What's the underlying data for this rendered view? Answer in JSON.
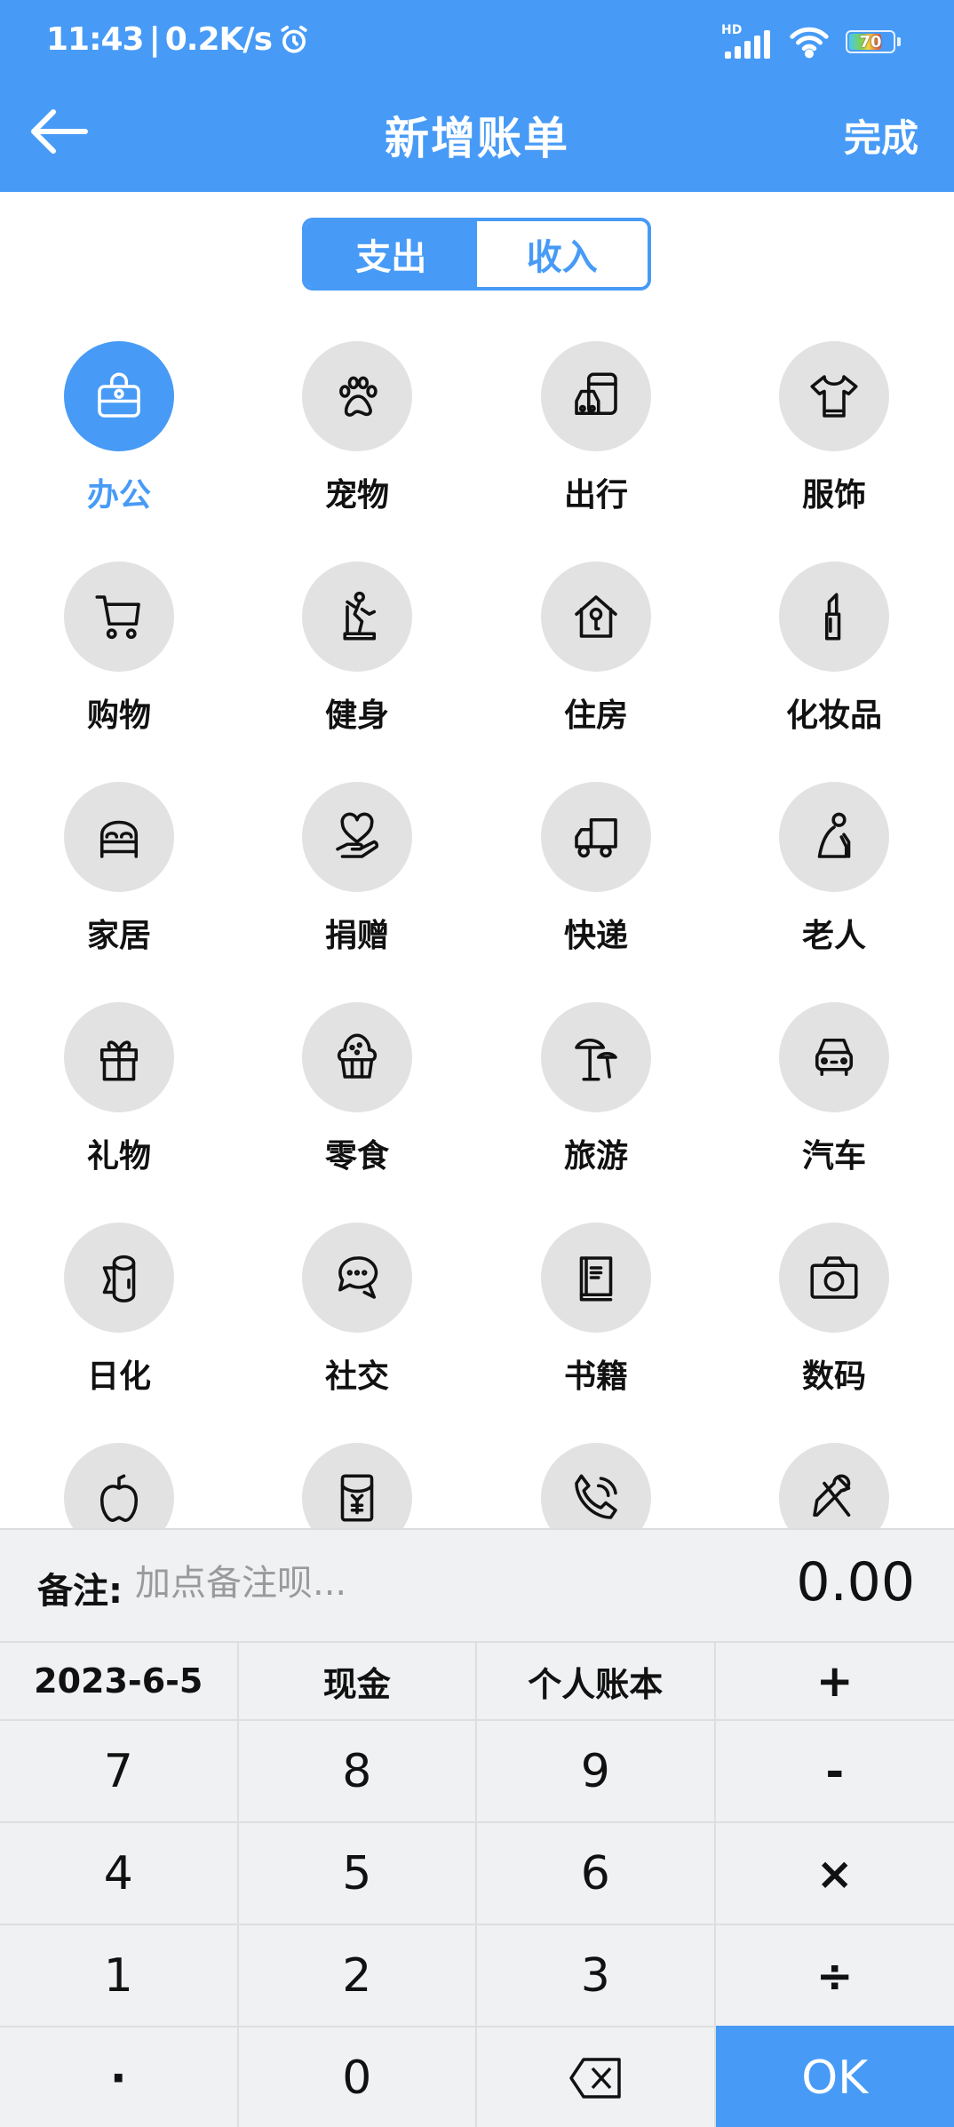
{
  "status_bar": {
    "time": "11:43",
    "net_speed": "0.2K/s",
    "alarm_icon": "alarm-clock-icon",
    "network_label": "HD",
    "battery_level": "70"
  },
  "header": {
    "back_icon": "arrow-left-icon",
    "title": "新增账单",
    "done_label": "完成"
  },
  "toggle": {
    "expense_label": "支出",
    "income_label": "收入",
    "selected": "支出"
  },
  "categories": [
    {
      "label": "办公",
      "icon": "briefcase-icon",
      "selected": true
    },
    {
      "label": "宠物",
      "icon": "paw-icon"
    },
    {
      "label": "出行",
      "icon": "bus-car-icon"
    },
    {
      "label": "服饰",
      "icon": "tshirt-icon"
    },
    {
      "label": "购物",
      "icon": "shopping-cart-icon"
    },
    {
      "label": "健身",
      "icon": "treadmill-icon"
    },
    {
      "label": "住房",
      "icon": "house-key-icon"
    },
    {
      "label": "化妆品",
      "icon": "lipstick-icon"
    },
    {
      "label": "家居",
      "icon": "bed-icon"
    },
    {
      "label": "捐赠",
      "icon": "heart-hand-icon"
    },
    {
      "label": "快递",
      "icon": "truck-icon"
    },
    {
      "label": "老人",
      "icon": "elderly-icon"
    },
    {
      "label": "礼物",
      "icon": "gift-icon"
    },
    {
      "label": "零食",
      "icon": "cupcake-icon"
    },
    {
      "label": "旅游",
      "icon": "beach-umbrella-icon"
    },
    {
      "label": "汽车",
      "icon": "car-icon"
    },
    {
      "label": "日化",
      "icon": "toilet-paper-icon"
    },
    {
      "label": "社交",
      "icon": "chat-bubbles-icon"
    },
    {
      "label": "书籍",
      "icon": "book-icon"
    },
    {
      "label": "数码",
      "icon": "camera-icon"
    },
    {
      "label": "",
      "icon": "apple-icon"
    },
    {
      "label": "",
      "icon": "red-envelope-icon"
    },
    {
      "label": "",
      "icon": "phone-icon"
    },
    {
      "label": "",
      "icon": "tools-icon"
    }
  ],
  "note": {
    "label": "备注:",
    "placeholder": "加点备注呗...",
    "value": ""
  },
  "amount": "0.00",
  "keypad": {
    "date": "2023-6-5",
    "account": "现金",
    "book": "个人账本",
    "keys": [
      "7",
      "8",
      "9",
      "-",
      "4",
      "5",
      "6",
      "×",
      "1",
      "2",
      "3",
      "÷",
      "·",
      "0"
    ],
    "plus": "+",
    "backspace_icon": "backspace-icon",
    "ok_label": "OK"
  },
  "colors": {
    "accent": "#479bf6",
    "icon_bg": "#e2e2e2",
    "panel_bg": "#f0f1f3"
  }
}
